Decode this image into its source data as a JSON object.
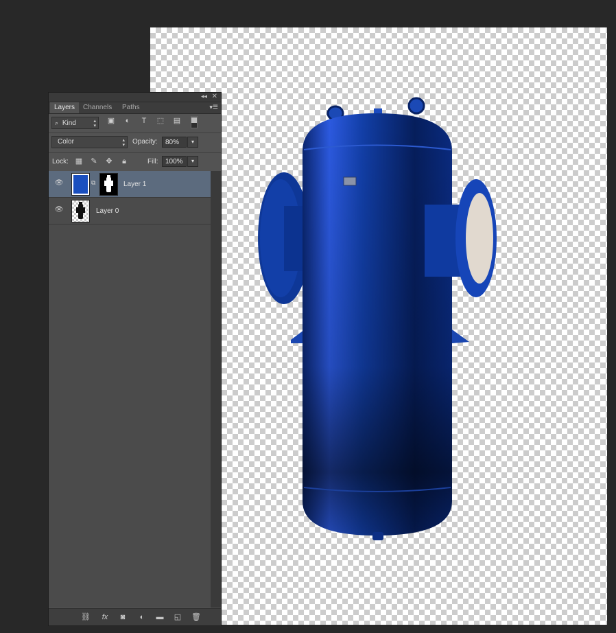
{
  "panel": {
    "collapse_icon": "double-chevron-left-icon",
    "close_icon": "close-icon",
    "tabs": [
      {
        "label": "Layers",
        "active": true
      },
      {
        "label": "Channels",
        "active": false
      },
      {
        "label": "Paths",
        "active": false
      }
    ],
    "filter": {
      "label": "Kind"
    },
    "blend_mode": "Color",
    "opacity": {
      "label": "Opacity:",
      "value": "80%"
    },
    "lock": {
      "label": "Lock:"
    },
    "fill": {
      "label": "Fill:",
      "value": "100%"
    },
    "layers": [
      {
        "name": "Layer 1",
        "selected": true,
        "visible": true,
        "thumb_color": "#1a4fbf",
        "has_mask": true
      },
      {
        "name": "Layer 0",
        "selected": false,
        "visible": true,
        "has_mask": false
      }
    ]
  },
  "colors": {
    "workspace": "#282828",
    "panel": "#535353",
    "selected_layer": "#5c6b7e",
    "vessel_blue": "#0d3a9a"
  }
}
